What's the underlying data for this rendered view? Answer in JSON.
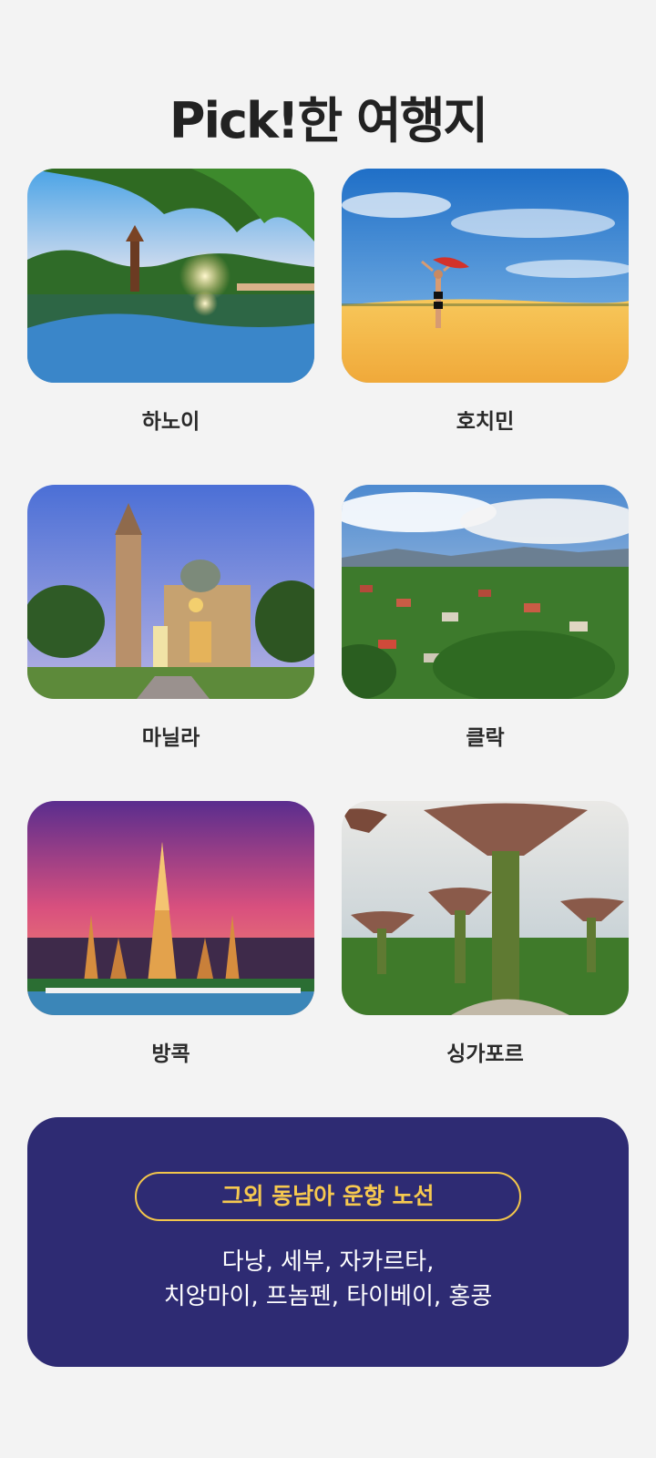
{
  "page": {
    "title": "Pick!한 여행지"
  },
  "destinations": [
    {
      "name": "하노이",
      "image": "hanoi-pagoda-lake-photo"
    },
    {
      "name": "호치민",
      "image": "desert-dune-woman-photo"
    },
    {
      "name": "마닐라",
      "image": "manila-cathedral-photo"
    },
    {
      "name": "클락",
      "image": "clark-aerial-town-photo"
    },
    {
      "name": "방콕",
      "image": "bangkok-temple-sunset-photo"
    },
    {
      "name": "싱가포르",
      "image": "singapore-supertree-grove-photo"
    }
  ],
  "other_routes": {
    "heading": "그외 동남아 운항 노선",
    "line1": "다낭, 세부, 자카르타,",
    "line2": "치앙마이, 프놈펜, 타이베이, 홍콩"
  },
  "colors": {
    "background": "#f3f3f3",
    "box": "#2e2b73",
    "accent": "#f3c64b",
    "title": "#222222"
  }
}
